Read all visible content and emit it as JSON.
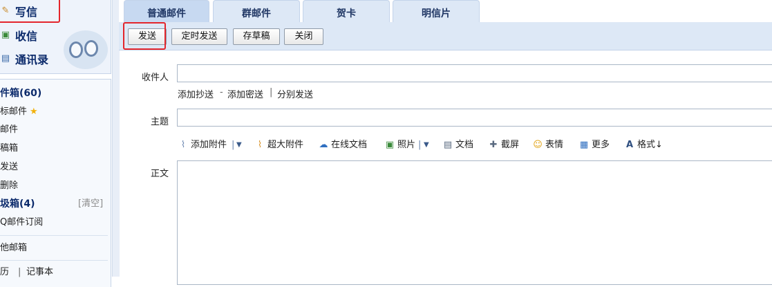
{
  "sidebar": {
    "quick": {
      "write": "写信",
      "inbox": "收信",
      "contacts": "通讯录"
    },
    "folders": {
      "inbox": "件箱(60)",
      "starred": "标邮件",
      "groups": "邮件",
      "drafts": "稿箱",
      "sent": "发送",
      "deleted": "删除",
      "junk": "圾箱(4)",
      "junk_clear": "[清空]",
      "qq_subscribe": "Q邮件订阅",
      "other": "他邮箱",
      "calendar": "历",
      "sep": "|",
      "notes": "记事本"
    }
  },
  "tabs": [
    "普通邮件",
    "群邮件",
    "贺卡",
    "明信片"
  ],
  "toolbar": {
    "send": "发送",
    "scheduled": "定时发送",
    "save_draft": "存草稿",
    "close": "关闭"
  },
  "compose": {
    "to_label": "收件人",
    "to_value": "",
    "add_cc": "添加抄送",
    "dash": "-",
    "add_bcc": "添加密送",
    "bar": "|",
    "separate_send": "分别发送",
    "subject_label": "主题",
    "subject_value": "",
    "body_label": "正文",
    "body_value": ""
  },
  "attach": {
    "add_attachment": "添加附件",
    "pipe": "|",
    "huge_attachment": "超大附件",
    "online_doc": "在线文档",
    "photo": "照片",
    "doc": "文档",
    "screenshot": "截屏",
    "emoji": "表情",
    "more": "更多",
    "format": "格式↓"
  },
  "icons": {
    "write": "pencil-icon",
    "inbox": "inbox-icon",
    "contacts": "address-book-icon",
    "star": "star-icon",
    "paperclip": "paperclip-icon",
    "huge": "paperclip-icon",
    "online_doc": "cloud-doc-icon",
    "photo": "photo-icon",
    "doc": "document-icon",
    "screenshot": "screenshot-icon",
    "emoji": "smiley-icon",
    "more": "grid-icon",
    "format": "font-icon",
    "dropdown": "caret-down-icon"
  },
  "colors": {
    "highlight": "#e4252b",
    "toolbar_bg": "#dde8f6",
    "star": "#f2b20c",
    "title_text": "#0b2a6b"
  }
}
